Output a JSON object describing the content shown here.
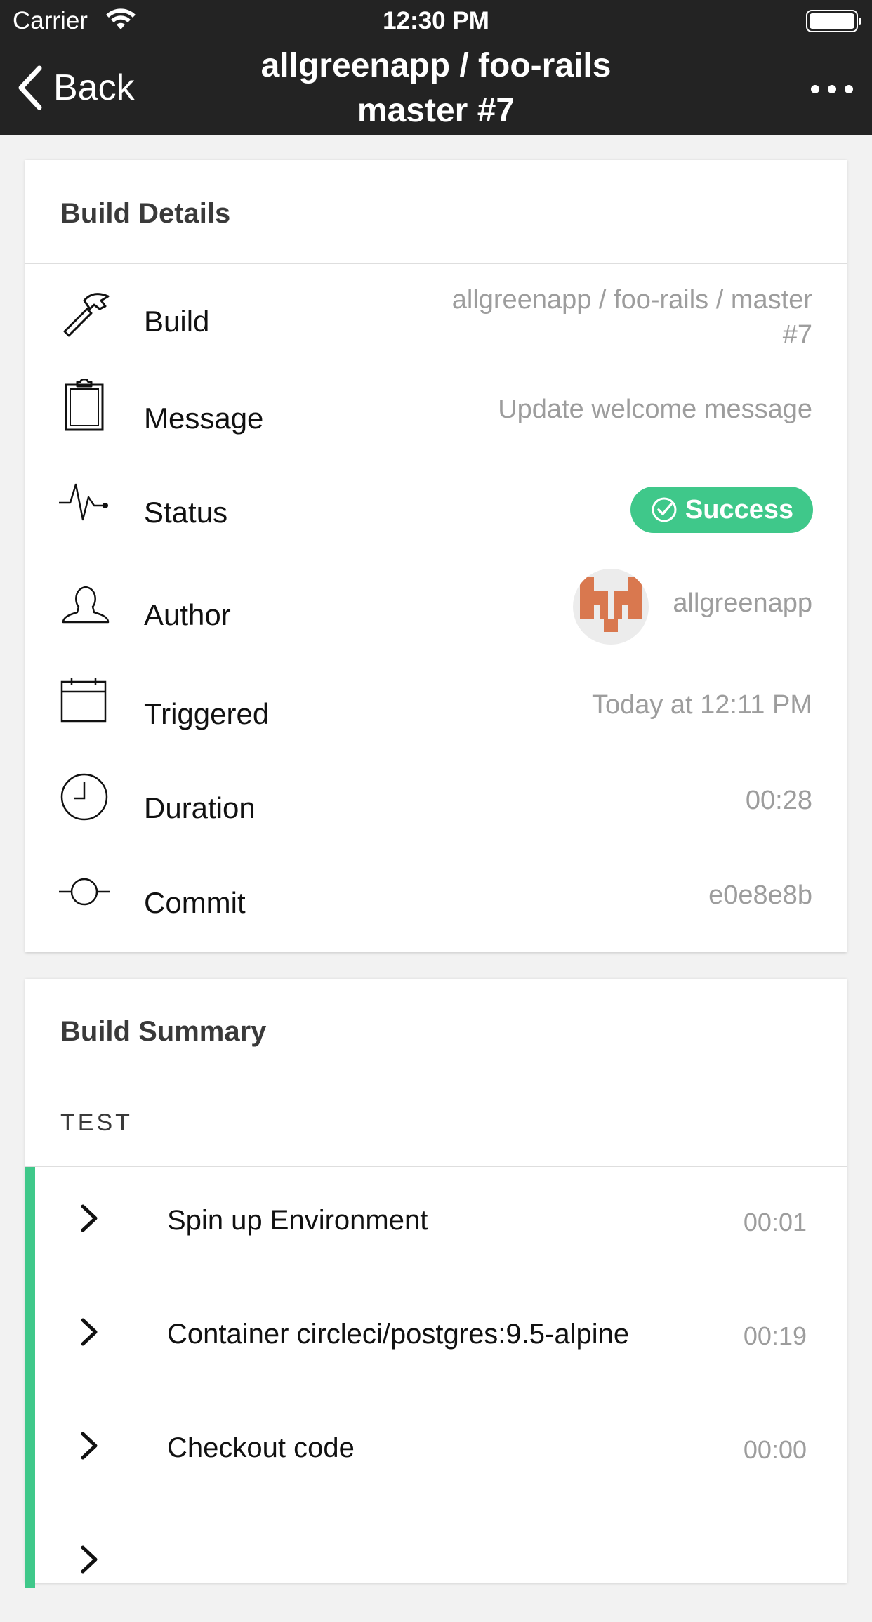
{
  "status_bar": {
    "carrier": "Carrier",
    "time": "12:30 PM"
  },
  "nav": {
    "back_label": "Back",
    "title_line1": "allgreenapp / foo-rails",
    "title_line2": "master #7"
  },
  "details": {
    "header": "Build Details",
    "rows": [
      {
        "icon": "hammer-icon",
        "label": "Build",
        "value_line1": "allgreenapp / foo-rails / master",
        "value_line2": "#7"
      },
      {
        "icon": "clipboard-icon",
        "label": "Message",
        "value": "Update welcome message"
      },
      {
        "icon": "pulse-icon",
        "label": "Status",
        "value": "Success"
      },
      {
        "icon": "person-icon",
        "label": "Author",
        "value": "allgreenapp"
      },
      {
        "icon": "calendar-icon",
        "label": "Triggered",
        "value": "Today at 12:11 PM"
      },
      {
        "icon": "clock-icon",
        "label": "Duration",
        "value": "00:28"
      },
      {
        "icon": "commit-icon",
        "label": "Commit",
        "value": "e0e8e8b"
      }
    ],
    "status_color": "#3fc88a",
    "avatar_color": "#d9784f"
  },
  "summary": {
    "header": "Build Summary",
    "section": "TEST",
    "steps": [
      {
        "name": "Spin up Environment",
        "time": "00:01"
      },
      {
        "name": "Container circleci/postgres:9.5-alpine",
        "time": "00:19"
      },
      {
        "name": "Checkout code",
        "time": "00:00"
      }
    ]
  }
}
